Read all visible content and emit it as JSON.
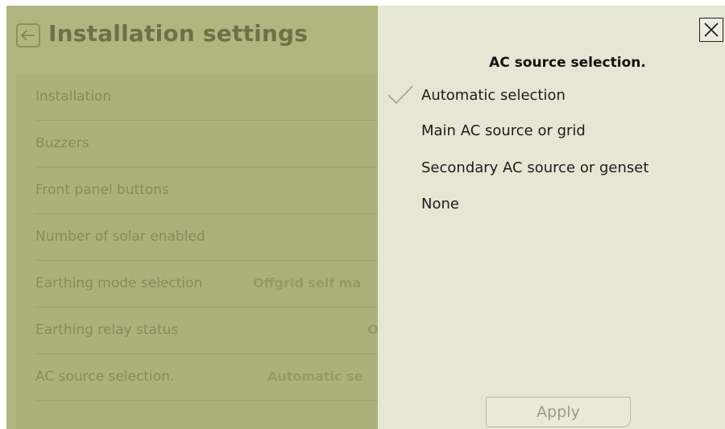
{
  "page": {
    "title": "Installation settings",
    "back_icon": "arrow-left-icon"
  },
  "settings_rows": [
    {
      "label": "Installation",
      "value": "",
      "control": "switch"
    },
    {
      "label": "Buzzers",
      "value": "",
      "control": "switch"
    },
    {
      "label": "Front panel buttons",
      "value": "",
      "control": "switch"
    },
    {
      "label": "Number of solar enabled",
      "value": "",
      "control": "none"
    },
    {
      "label": "Earthing mode selection",
      "value": "Offgrid self ma",
      "control": "value"
    },
    {
      "label": "Earthing relay status",
      "value": "O",
      "control": "value"
    },
    {
      "label": "AC source selection.",
      "value": "Automatic se",
      "control": "value"
    }
  ],
  "popup": {
    "title": "AC source selection.",
    "close_icon": "close-icon",
    "options": [
      {
        "label": "Automatic selection",
        "selected": true
      },
      {
        "label": "Main AC source or grid",
        "selected": false
      },
      {
        "label": "Secondary AC source or genset",
        "selected": false
      },
      {
        "label": "None",
        "selected": false
      }
    ],
    "apply_label": "Apply"
  },
  "colors": {
    "overlay_bg": "#b3b581",
    "popup_bg": "#e6e6d5",
    "check": "#a9ab86"
  }
}
